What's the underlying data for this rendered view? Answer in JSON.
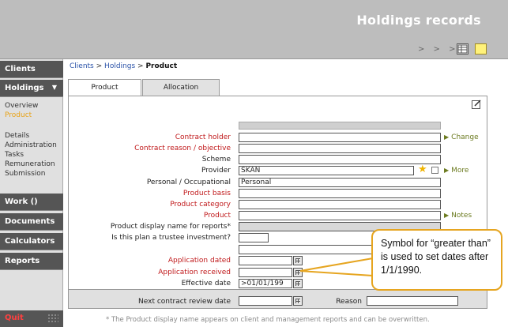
{
  "app": {
    "title": "Holdings records",
    "nav_arrows": "> > >"
  },
  "breadcrumb": {
    "clients": "Clients",
    "sep1": ">",
    "holdings": "Holdings",
    "sep2": ">",
    "current": "Product"
  },
  "sidebar": {
    "clients": "Clients",
    "holdings": "Holdings",
    "holdings_caret": "▼",
    "holdings_sub_a": [
      "Overview",
      "Product"
    ],
    "holdings_sub_b": [
      "Details",
      "Administration",
      "Tasks",
      "Remuneration",
      "Submission"
    ],
    "work": "Work ()",
    "documents": "Documents",
    "calculators": "Calculators",
    "reports": "Reports",
    "quit": "Quit"
  },
  "tabs": {
    "product": "Product",
    "allocation": "Allocation"
  },
  "form": {
    "contract_holder": "Contract holder",
    "contract_reason": "Contract reason / objective",
    "scheme": "Scheme",
    "provider": "Provider",
    "provider_value": "SKAN",
    "personal_occupational": "Personal / Occupational",
    "personal_occupational_value": "Personal",
    "product_basis": "Product basis",
    "product_category": "Product category",
    "product": "Product",
    "display_name": "Product display name for reports*",
    "trustee": "Is this plan a trustee investment?",
    "application_dated": "Application dated",
    "application_received": "Application received",
    "effective_date": "Effective date",
    "effective_date_value": ">01/01/199",
    "next_review": "Next contract review date",
    "reason": "Reason"
  },
  "links": {
    "change": "Change",
    "more": "More",
    "notes": "Notes"
  },
  "footnote": "* The Product display name appears on client and management reports and can be overwritten.",
  "callout": {
    "text": "Symbol for “greater than” is used to set dates after 1/1/1990."
  },
  "colors": {
    "required_label": "#c0191b",
    "active_nav": "#e8a317",
    "callout_border": "#e6a520",
    "link": "#6b7a1f"
  }
}
